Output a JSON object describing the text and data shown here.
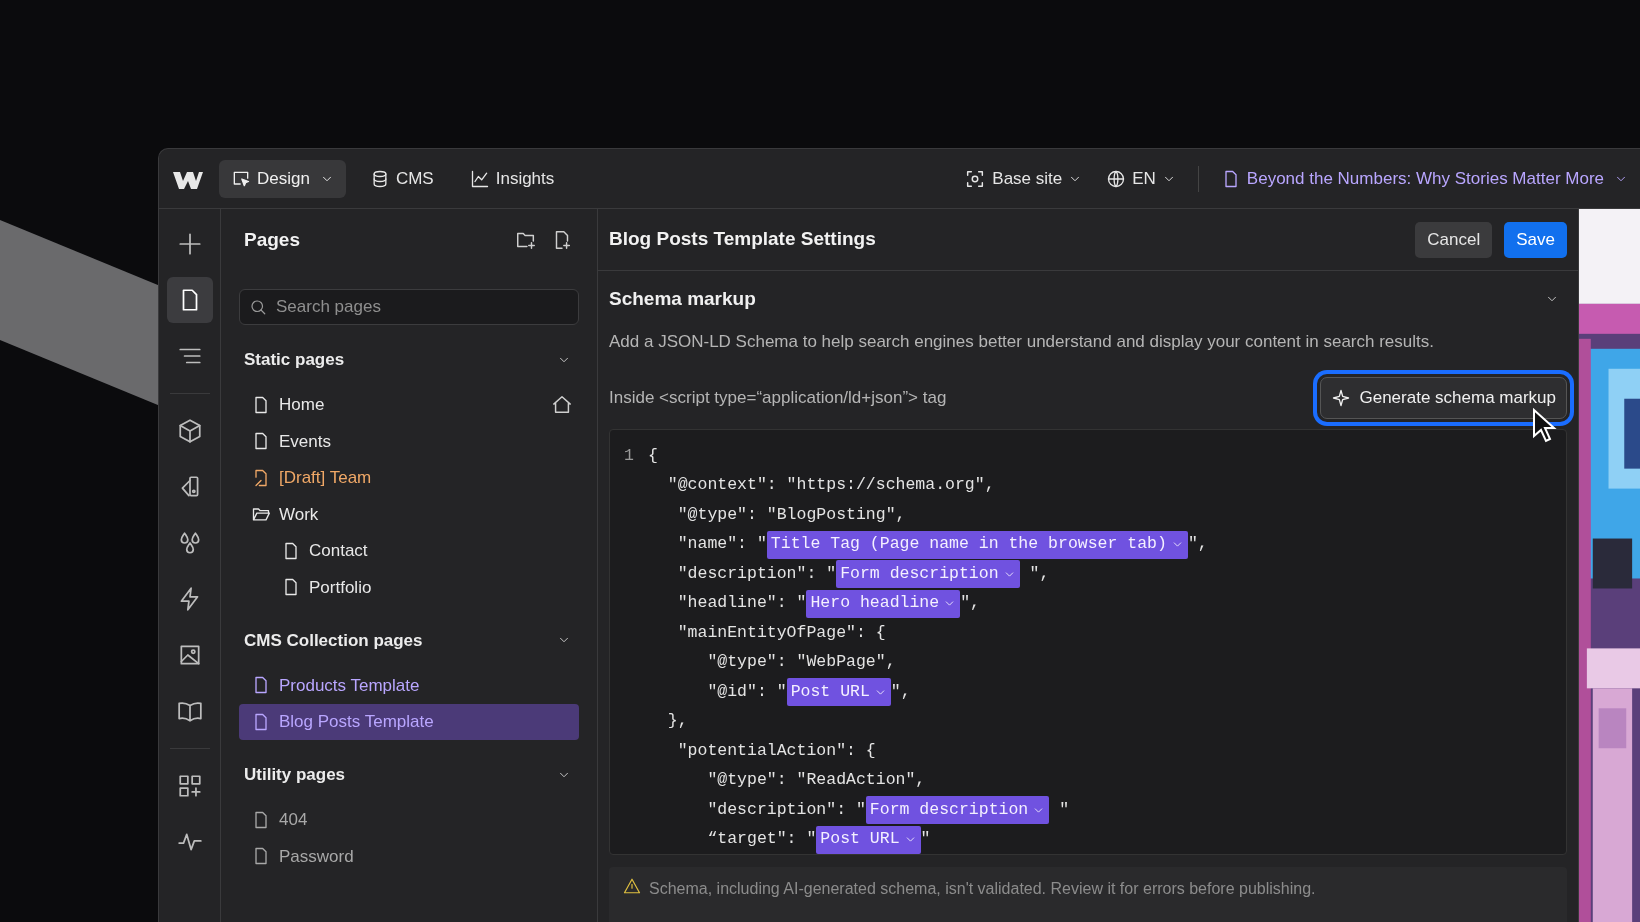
{
  "topbar": {
    "modes": [
      {
        "label": "Design",
        "kind": "design",
        "selected": true,
        "dropdown": true
      },
      {
        "label": "CMS",
        "kind": "cms",
        "selected": false,
        "dropdown": false
      },
      {
        "label": "Insights",
        "kind": "insights",
        "selected": false,
        "dropdown": false
      }
    ],
    "locale": "Base site",
    "language": "EN",
    "page": "Beyond the Numbers: Why Stories Matter More"
  },
  "rail": [
    {
      "kind": "add",
      "selected": false
    },
    {
      "kind": "pages",
      "selected": true
    },
    {
      "kind": "navigator",
      "selected": false
    },
    {
      "kind": "divider"
    },
    {
      "kind": "components",
      "selected": false
    },
    {
      "kind": "styles",
      "selected": false
    },
    {
      "kind": "variables",
      "selected": false
    },
    {
      "kind": "interactions",
      "selected": false
    },
    {
      "kind": "assets",
      "selected": false
    },
    {
      "kind": "library",
      "selected": false
    },
    {
      "kind": "divider"
    },
    {
      "kind": "apps",
      "selected": false
    },
    {
      "kind": "audit",
      "selected": false
    }
  ],
  "pages_panel": {
    "title": "Pages",
    "search": {
      "placeholder": "Search pages"
    },
    "sections": [
      {
        "title": "Static pages",
        "expanded": true,
        "items": [
          {
            "label": "Home",
            "kind": "page",
            "selected": false,
            "home": true
          },
          {
            "label": "Events",
            "kind": "page",
            "selected": false
          },
          {
            "label": "[Draft] Team",
            "kind": "draft",
            "selected": false
          },
          {
            "label": "Work",
            "kind": "folder",
            "selected": false,
            "children": [
              {
                "label": "Contact",
                "kind": "page",
                "selected": false
              },
              {
                "label": "Portfolio",
                "kind": "page",
                "selected": false
              }
            ]
          }
        ]
      },
      {
        "title": "CMS Collection pages",
        "expanded": true,
        "items": [
          {
            "label": "Products Template",
            "kind": "template",
            "selected": false
          },
          {
            "label": "Blog Posts Template",
            "kind": "template",
            "selected": true
          }
        ]
      },
      {
        "title": "Utility pages",
        "expanded": true,
        "items": [
          {
            "label": "404",
            "kind": "utility",
            "selected": false
          },
          {
            "label": "Password",
            "kind": "utility",
            "selected": false
          }
        ]
      }
    ]
  },
  "settings": {
    "title": "Blog Posts Template Settings",
    "buttons": [
      {
        "label": "Cancel",
        "kind": "secondary"
      },
      {
        "label": "Save",
        "kind": "primary"
      }
    ],
    "section": {
      "title": "Schema markup",
      "expanded": true,
      "description": "Add a JSON-LD Schema to help search engines better understand and display your content in search results.",
      "code_label": "Inside <script type=“application/ld+json”> tag",
      "generate_button": {
        "label": "Generate schema markup",
        "focused": true
      },
      "code": [
        {
          "number": "1",
          "segments": [
            {
              "kind": "text",
              "text": "{"
            }
          ]
        },
        {
          "segments": [
            {
              "kind": "text",
              "text": "  \"@context\": \"https://schema.org\","
            }
          ]
        },
        {
          "segments": [
            {
              "kind": "text",
              "text": "   \"@type\": \"BlogPosting\","
            }
          ]
        },
        {
          "segments": [
            {
              "kind": "text",
              "text": "   \"name\": \""
            },
            {
              "kind": "token",
              "text": "Title Tag (Page name in the browser tab)"
            },
            {
              "kind": "text",
              "text": "\","
            }
          ]
        },
        {
          "segments": [
            {
              "kind": "text",
              "text": "   \"description\": \""
            },
            {
              "kind": "token",
              "text": "Form description"
            },
            {
              "kind": "text",
              "text": " \","
            }
          ]
        },
        {
          "segments": [
            {
              "kind": "text",
              "text": "   \"headline\": \""
            },
            {
              "kind": "token",
              "text": "Hero headline"
            },
            {
              "kind": "text",
              "text": "\","
            }
          ]
        },
        {
          "segments": [
            {
              "kind": "text",
              "text": "   \"mainEntityOfPage\": {"
            }
          ]
        },
        {
          "segments": [
            {
              "kind": "text",
              "text": "      \"@type\": \"WebPage\","
            }
          ]
        },
        {
          "segments": [
            {
              "kind": "text",
              "text": "      \"@id\": \""
            },
            {
              "kind": "token",
              "text": "Post URL"
            },
            {
              "kind": "text",
              "text": "\","
            }
          ]
        },
        {
          "segments": [
            {
              "kind": "text",
              "text": "  },"
            }
          ]
        },
        {
          "segments": [
            {
              "kind": "text",
              "text": "   \"potentialAction\": {"
            }
          ]
        },
        {
          "segments": [
            {
              "kind": "text",
              "text": "      \"@type\": \"ReadAction\","
            }
          ]
        },
        {
          "segments": [
            {
              "kind": "text",
              "text": "      \"description\": \""
            },
            {
              "kind": "token",
              "text": "Form description"
            },
            {
              "kind": "text",
              "text": " \""
            }
          ]
        },
        {
          "segments": [
            {
              "kind": "text",
              "text": "      “target\": \""
            },
            {
              "kind": "token",
              "text": "Post URL"
            },
            {
              "kind": "text",
              "text": "\""
            }
          ]
        }
      ]
    },
    "warning": "Schema, including AI-generated schema, isn't validated. Review it for errors before publishing."
  }
}
